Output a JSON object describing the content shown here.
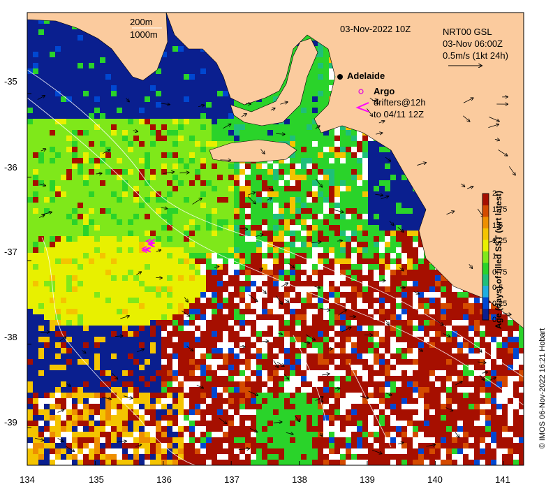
{
  "map": {
    "timestamp": "03-Nov-2022 10Z",
    "product": "NRT00 GSL",
    "current_time": "03-Nov 06:00Z",
    "vector_scale": "0.5m/s (1kt 24h)",
    "depth_200": "200m",
    "depth_1000": "1000m",
    "city": "Adelaide",
    "argo_label": "Argo",
    "drifters_line1": "drifters@12h",
    "drifters_line2": "to 04/11 12Z",
    "credit": "© IMOS 06-Nov-2022 16:21 Hobart",
    "colors": {
      "land": "#FBCB9E",
      "no_data": "#FFFFFF",
      "argo_marker": "#E000E0",
      "drifter": "#FF00FF"
    },
    "ocean_age_palette": [
      "#0a1f8f",
      "#0047d1",
      "#1faee0",
      "#1fbf7a",
      "#2ad32a",
      "#7fe81a",
      "#e8f000",
      "#f4c400",
      "#ee8f00",
      "#d44b00",
      "#a60f00"
    ]
  },
  "axes": {
    "x_ticks": [
      "134",
      "135",
      "136",
      "137",
      "138",
      "139",
      "140",
      "141"
    ],
    "x_values": [
      134,
      135,
      136,
      137,
      138,
      139,
      140,
      141
    ],
    "y_ticks": [
      "-35",
      "-36",
      "-37",
      "-38",
      "-39"
    ],
    "y_values": [
      -35,
      -36,
      -37,
      -38,
      -39
    ],
    "x_range": [
      134,
      141.3
    ],
    "y_range": [
      -39.45,
      -34.03
    ]
  },
  "colorbar": {
    "title": "Age (days) of filled SST (wrt latest)",
    "range": [
      0,
      2
    ],
    "tick_labels": [
      "0",
      "0.25",
      "0.5",
      "0.75",
      "1",
      "1.25",
      "1.5",
      "1.75",
      "2"
    ],
    "tick_values": [
      0,
      0.25,
      0.5,
      0.75,
      1,
      1.25,
      1.5,
      1.75,
      2
    ]
  }
}
